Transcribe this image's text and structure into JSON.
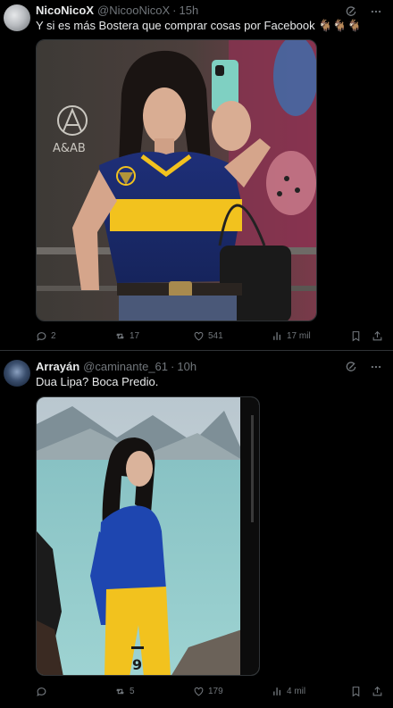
{
  "tweets": [
    {
      "name": "NicoNicoX",
      "handle": "@NicooNicoX",
      "separator": "·",
      "time": "15h",
      "text": "Y si es más Bostera que comprar cosas por Facebook 🐐🐐🐐",
      "media_alt_icon": "photo-mirror-selfie",
      "replies": "2",
      "reposts": "17",
      "likes": "541",
      "views": "17 mil"
    },
    {
      "name": "Arrayán",
      "handle": "@caminante_61",
      "separator": "·",
      "time": "10h",
      "text": "Dua Lipa? Boca Predio.",
      "media_alt_icon": "photo-lake-landscape",
      "replies": "",
      "reposts": "5",
      "likes": "179",
      "views": "4 mil"
    }
  ],
  "colors": {
    "background": "#000000",
    "text_primary": "#e7e9ea",
    "text_secondary": "#71767b",
    "divider": "#2f3336"
  }
}
